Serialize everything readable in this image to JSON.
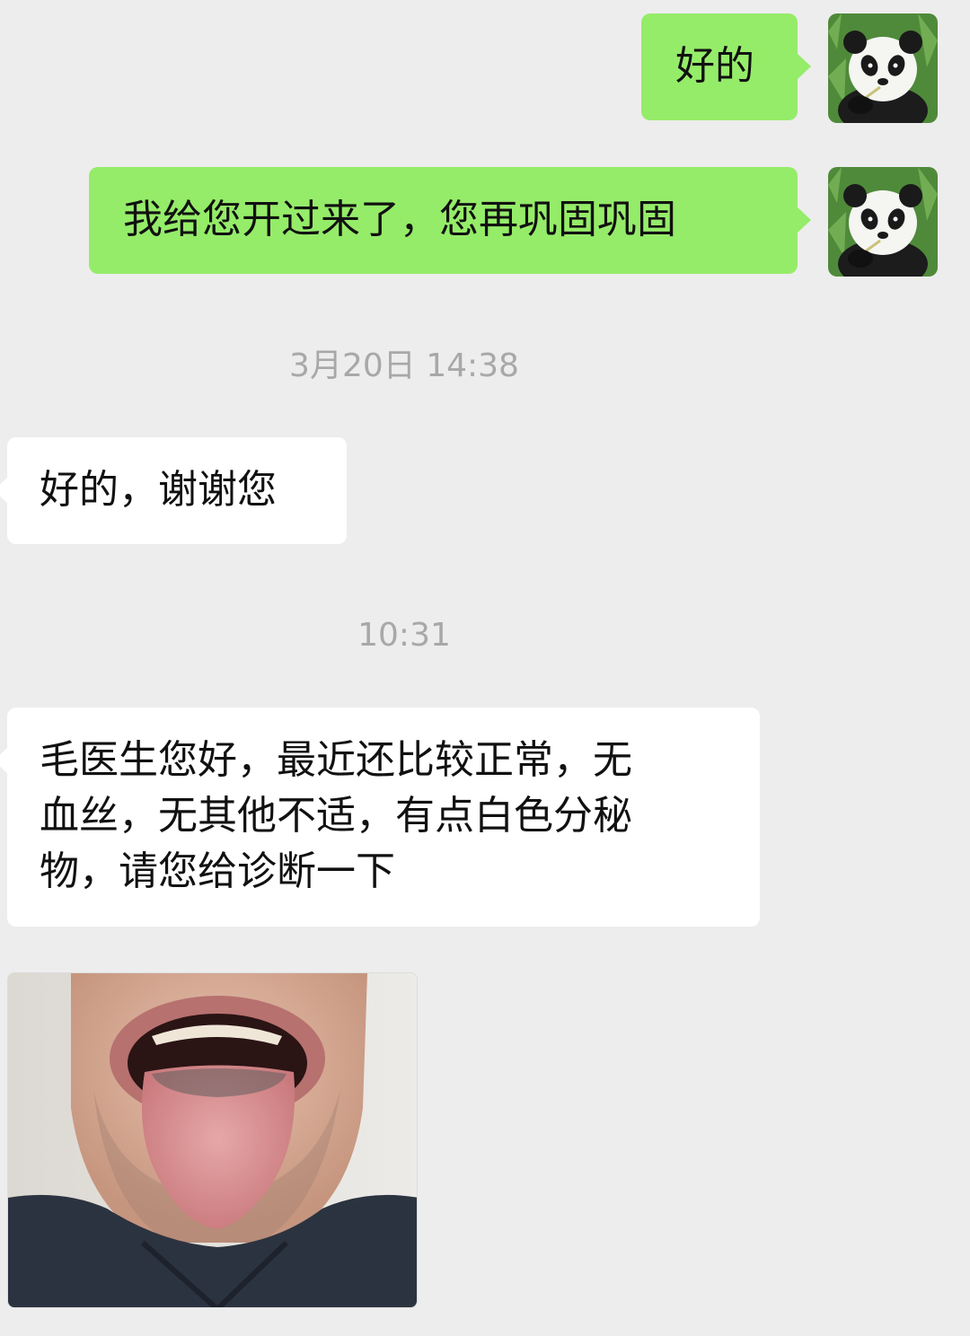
{
  "messages": [
    {
      "side": "right",
      "text": "好的"
    },
    {
      "side": "right",
      "text": "我给您开过来了，您再巩固巩固"
    },
    {
      "side": "left",
      "text": "好的，谢谢您"
    },
    {
      "side": "left",
      "lines": [
        "毛医生您好，最近还比较正常，无",
        "血丝，无其他不适，有点白色分秘",
        "物，请您给诊断一下"
      ]
    }
  ],
  "timestamps": [
    "3月20日 14:38",
    "10:31"
  ],
  "colors": {
    "background": "#ededed",
    "self_bubble": "#95ec69",
    "other_bubble": "#ffffff",
    "timestamp_text": "#a8a8a8"
  },
  "icons": {
    "avatar": "panda-avatar-photo",
    "image_message": "tongue-photo"
  }
}
